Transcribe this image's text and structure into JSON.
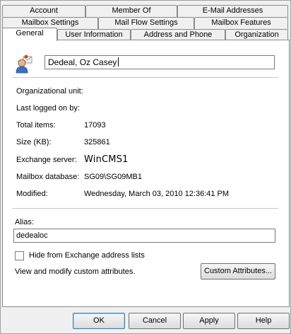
{
  "tabs": {
    "row1": [
      "Account",
      "Member Of",
      "E-Mail Addresses"
    ],
    "row2": [
      "Mailbox Settings",
      "Mail Flow Settings",
      "Mailbox Features"
    ],
    "row3": [
      "General",
      "User Information",
      "Address and Phone",
      "Organization"
    ]
  },
  "general": {
    "display_name": "Dedeal, Oz Casey",
    "fields": {
      "org_unit_label": "Organizational unit:",
      "org_unit_value": "",
      "last_logon_label": "Last logged on by:",
      "last_logon_value": "",
      "total_items_label": "Total items:",
      "total_items_value": "17093",
      "size_label": "Size (KB):",
      "size_value": "325861",
      "server_label": "Exchange server:",
      "server_value": "WinCMS1",
      "database_label": "Mailbox database:",
      "database_value": "SG09\\SG09MB1",
      "modified_label": "Modified:",
      "modified_value": "Wednesday, March 03, 2010 12:36:41 PM"
    },
    "alias_label": "Alias:",
    "alias_value": "dedealoc",
    "hide_label": "Hide from Exchange address lists",
    "hide_checked": false,
    "custom_attr_text": "View and modify custom attributes.",
    "custom_attr_button": "Custom Attributes..."
  },
  "buttons": {
    "ok": "OK",
    "cancel": "Cancel",
    "apply": "Apply",
    "help": "Help"
  },
  "icons": {
    "user": "mailbox-user-icon"
  }
}
